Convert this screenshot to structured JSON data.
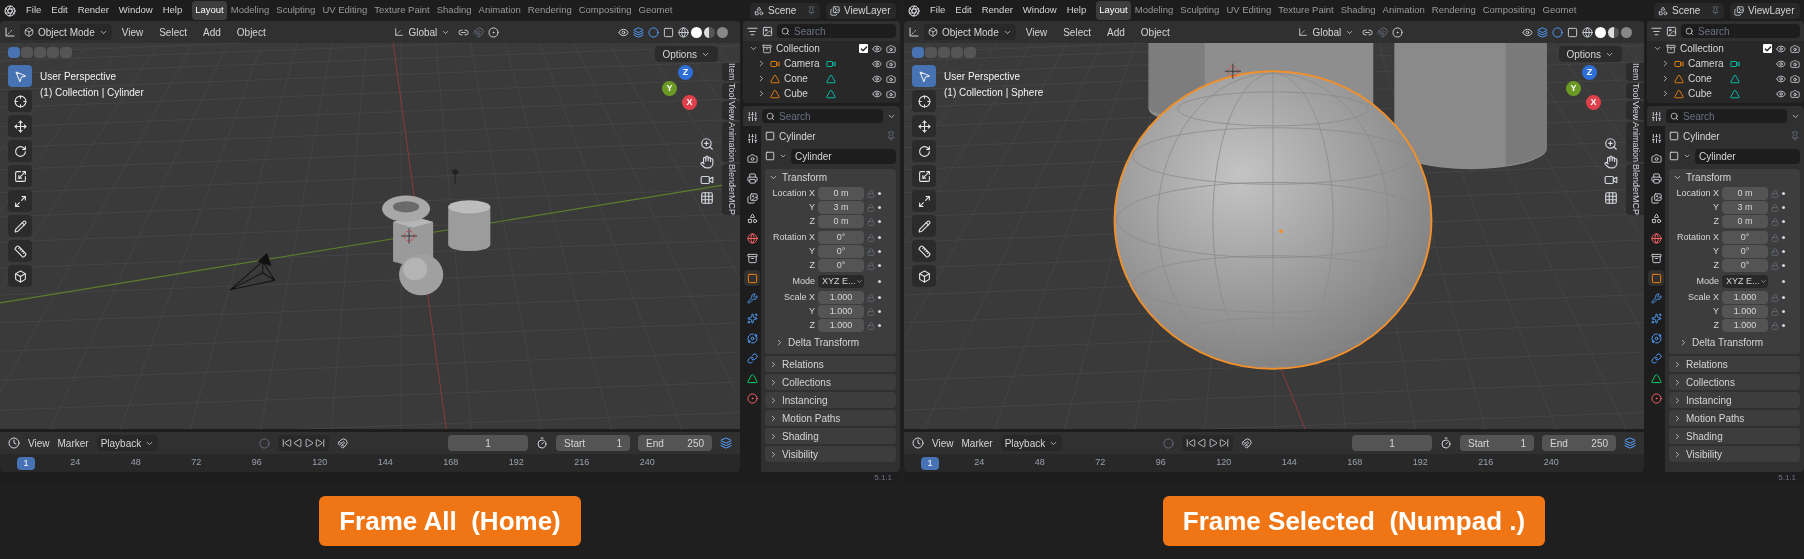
{
  "panels": [
    {
      "menus": [
        "File",
        "Edit",
        "Render",
        "Window",
        "Help"
      ],
      "workspaces": [
        {
          "label": "Layout",
          "selected": true
        },
        {
          "label": "Modeling",
          "selected": false
        },
        {
          "label": "Sculpting",
          "selected": false
        },
        {
          "label": "UV Editing",
          "selected": false
        },
        {
          "label": "Texture Paint",
          "selected": false
        },
        {
          "label": "Shading",
          "selected": false
        },
        {
          "label": "Animation",
          "selected": false
        },
        {
          "label": "Rendering",
          "selected": false
        },
        {
          "label": "Compositing",
          "selected": false
        },
        {
          "label": "Geomet",
          "selected": false
        }
      ],
      "scene": "Scene",
      "view_layer": "ViewLayer",
      "viewport_header": {
        "mode": "Object Mode",
        "menus": [
          "View",
          "Select",
          "Add",
          "Object"
        ],
        "orientation": "Global",
        "options": "Options"
      },
      "viewport": {
        "kind": "overview",
        "perspective": "User Perspective",
        "context": "(1) Collection | Cylinder",
        "tools": [
          {
            "kind": "select",
            "selected": true
          },
          {
            "kind": "cursor",
            "selected": false
          },
          {
            "kind": "move",
            "selected": false
          },
          {
            "kind": "rotate",
            "selected": false
          },
          {
            "kind": "scale",
            "selected": false
          },
          {
            "kind": "transform",
            "selected": false
          },
          {
            "kind": "annotate",
            "selected": false
          },
          {
            "kind": "measure",
            "selected": false
          },
          {
            "kind": "add_cube",
            "selected": false
          }
        ],
        "gizmo": [
          {
            "label": "Z",
            "color": "#2e6fd8"
          },
          {
            "label": "Y",
            "color": "#6a9a23"
          },
          {
            "label": "X",
            "color": "#e0404a"
          }
        ],
        "sidebar_tabs": [
          {
            "label": "Item",
            "selected": false
          },
          {
            "label": "Tool",
            "selected": false
          },
          {
            "label": "View",
            "selected": false
          },
          {
            "label": "Animation",
            "selected": false
          },
          {
            "label": "BlenderMCP",
            "selected": false
          }
        ]
      },
      "outliner": {
        "search_placeholder": "Search",
        "collection": "Collection",
        "collection_checked": true,
        "items": [
          {
            "name": "Camera",
            "kind": "camera"
          },
          {
            "name": "Cone",
            "kind": "mesh"
          },
          {
            "name": "Cube",
            "kind": "mesh"
          }
        ]
      },
      "properties": {
        "search_placeholder": "Search",
        "object": "Cylinder",
        "datablock": "Cylinder",
        "tabs": [
          {
            "kind": "tool",
            "selected": false
          },
          {
            "kind": "render",
            "selected": false
          },
          {
            "kind": "output",
            "selected": false
          },
          {
            "kind": "view_layer",
            "selected": false
          },
          {
            "kind": "scene",
            "selected": false
          },
          {
            "kind": "world",
            "selected": false
          },
          {
            "kind": "collection",
            "selected": false
          },
          {
            "kind": "object",
            "selected": true
          },
          {
            "kind": "modifiers",
            "selected": false
          },
          {
            "kind": "particles",
            "selected": false
          },
          {
            "kind": "physics",
            "selected": false
          },
          {
            "kind": "constraints",
            "selected": false
          },
          {
            "kind": "data",
            "selected": false
          },
          {
            "kind": "material",
            "selected": false
          }
        ],
        "transform": {
          "title": "Transform",
          "expanded": true,
          "groups": [
            {
              "label": "Location",
              "rows": [
                {
                  "axis": "X",
                  "value": "0 m"
                },
                {
                  "axis": "Y",
                  "value": "3 m"
                },
                {
                  "axis": "Z",
                  "value": "0 m"
                }
              ]
            },
            {
              "label": "Rotation",
              "rows": [
                {
                  "axis": "X",
                  "value": "0°"
                },
                {
                  "axis": "Y",
                  "value": "0°"
                },
                {
                  "axis": "Z",
                  "value": "0°"
                }
              ]
            },
            {
              "label": "Mode",
              "rows": [
                {
                  "axis": "",
                  "value": "XYZ E..."
                }
              ],
              "dropdown": true
            },
            {
              "label": "Scale",
              "rows": [
                {
                  "axis": "X",
                  "value": "1.000"
                },
                {
                  "axis": "Y",
                  "value": "1.000"
                },
                {
                  "axis": "Z",
                  "value": "1.000"
                }
              ]
            }
          ],
          "subpanel": {
            "title": "Delta Transform",
            "expanded": false
          }
        },
        "panels": [
          {
            "title": "Relations",
            "expanded": false
          },
          {
            "title": "Collections",
            "expanded": false
          },
          {
            "title": "Instancing",
            "expanded": false
          },
          {
            "title": "Motion Paths",
            "expanded": false
          },
          {
            "title": "Shading",
            "expanded": false
          },
          {
            "title": "Visibility",
            "expanded": false
          }
        ]
      },
      "timeline": {
        "menus": [
          "View",
          "Marker"
        ],
        "playback": "Playback",
        "frame": "1",
        "start_label": "Start",
        "start": "1",
        "end_label": "End",
        "end": "250",
        "current": "1",
        "ticks": [
          "24",
          "48",
          "72",
          "96",
          "120",
          "144",
          "168",
          "192",
          "216",
          "240"
        ]
      },
      "version": "5.1.1",
      "caption": "Frame All  (Home)"
    },
    {
      "menus": [
        "File",
        "Edit",
        "Render",
        "Window",
        "Help"
      ],
      "workspaces": [
        {
          "label": "Layout",
          "selected": true
        },
        {
          "label": "Modeling",
          "selected": false
        },
        {
          "label": "Sculpting",
          "selected": false
        },
        {
          "label": "UV Editing",
          "selected": false
        },
        {
          "label": "Texture Paint",
          "selected": false
        },
        {
          "label": "Shading",
          "selected": false
        },
        {
          "label": "Animation",
          "selected": false
        },
        {
          "label": "Rendering",
          "selected": false
        },
        {
          "label": "Compositing",
          "selected": false
        },
        {
          "label": "Geomet",
          "selected": false
        }
      ],
      "scene": "Scene",
      "view_layer": "ViewLayer",
      "viewport_header": {
        "mode": "Object Mode",
        "menus": [
          "View",
          "Select",
          "Add",
          "Object"
        ],
        "orientation": "Global",
        "options": "Options"
      },
      "viewport": {
        "kind": "closeup",
        "perspective": "User Perspective",
        "context": "(1) Collection | Sphere",
        "tools": [
          {
            "kind": "select",
            "selected": true
          },
          {
            "kind": "cursor",
            "selected": false
          },
          {
            "kind": "move",
            "selected": false
          },
          {
            "kind": "rotate",
            "selected": false
          },
          {
            "kind": "scale",
            "selected": false
          },
          {
            "kind": "transform",
            "selected": false
          },
          {
            "kind": "annotate",
            "selected": false
          },
          {
            "kind": "measure",
            "selected": false
          },
          {
            "kind": "add_cube",
            "selected": false
          }
        ],
        "gizmo": [
          {
            "label": "Z",
            "color": "#2e6fd8"
          },
          {
            "label": "Y",
            "color": "#6a9a23"
          },
          {
            "label": "X",
            "color": "#e0404a"
          }
        ],
        "sidebar_tabs": [
          {
            "label": "Item",
            "selected": false
          },
          {
            "label": "Tool",
            "selected": false
          },
          {
            "label": "View",
            "selected": false
          },
          {
            "label": "Animation",
            "selected": false
          },
          {
            "label": "BlenderMCP",
            "selected": false
          }
        ]
      },
      "outliner": {
        "search_placeholder": "Search",
        "collection": "Collection",
        "collection_checked": true,
        "items": [
          {
            "name": "Camera",
            "kind": "camera"
          },
          {
            "name": "Cone",
            "kind": "mesh"
          },
          {
            "name": "Cube",
            "kind": "mesh"
          }
        ]
      },
      "properties": {
        "search_placeholder": "Search",
        "object": "Cylinder",
        "datablock": "Cylinder",
        "tabs": [
          {
            "kind": "tool",
            "selected": false
          },
          {
            "kind": "render",
            "selected": false
          },
          {
            "kind": "output",
            "selected": false
          },
          {
            "kind": "view_layer",
            "selected": false
          },
          {
            "kind": "scene",
            "selected": false
          },
          {
            "kind": "world",
            "selected": false
          },
          {
            "kind": "collection",
            "selected": false
          },
          {
            "kind": "object",
            "selected": true
          },
          {
            "kind": "modifiers",
            "selected": false
          },
          {
            "kind": "particles",
            "selected": false
          },
          {
            "kind": "physics",
            "selected": false
          },
          {
            "kind": "constraints",
            "selected": false
          },
          {
            "kind": "data",
            "selected": false
          },
          {
            "kind": "material",
            "selected": false
          }
        ],
        "transform": {
          "title": "Transform",
          "expanded": true,
          "groups": [
            {
              "label": "Location",
              "rows": [
                {
                  "axis": "X",
                  "value": "0 m"
                },
                {
                  "axis": "Y",
                  "value": "3 m"
                },
                {
                  "axis": "Z",
                  "value": "0 m"
                }
              ]
            },
            {
              "label": "Rotation",
              "rows": [
                {
                  "axis": "X",
                  "value": "0°"
                },
                {
                  "axis": "Y",
                  "value": "0°"
                },
                {
                  "axis": "Z",
                  "value": "0°"
                }
              ]
            },
            {
              "label": "Mode",
              "rows": [
                {
                  "axis": "",
                  "value": "XYZ E..."
                }
              ],
              "dropdown": true
            },
            {
              "label": "Scale",
              "rows": [
                {
                  "axis": "X",
                  "value": "1.000"
                },
                {
                  "axis": "Y",
                  "value": "1.000"
                },
                {
                  "axis": "Z",
                  "value": "1.000"
                }
              ]
            }
          ],
          "subpanel": {
            "title": "Delta Transform",
            "expanded": false
          }
        },
        "panels": [
          {
            "title": "Relations",
            "expanded": false
          },
          {
            "title": "Collections",
            "expanded": false
          },
          {
            "title": "Instancing",
            "expanded": false
          },
          {
            "title": "Motion Paths",
            "expanded": false
          },
          {
            "title": "Shading",
            "expanded": false
          },
          {
            "title": "Visibility",
            "expanded": false
          }
        ]
      },
      "timeline": {
        "menus": [
          "View",
          "Marker"
        ],
        "playback": "Playback",
        "frame": "1",
        "start_label": "Start",
        "start": "1",
        "end_label": "End",
        "end": "250",
        "current": "1",
        "ticks": [
          "24",
          "48",
          "72",
          "96",
          "120",
          "144",
          "168",
          "192",
          "216",
          "240"
        ]
      },
      "version": "5.1.1",
      "caption": "Frame Selected  (Numpad .)"
    }
  ]
}
